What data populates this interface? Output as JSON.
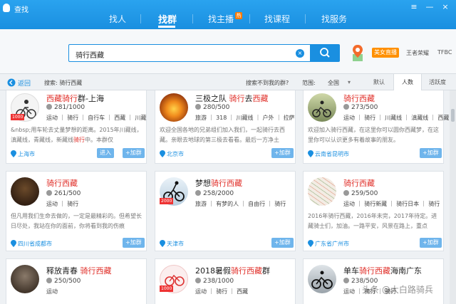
{
  "window": {
    "title": "查找",
    "controls": [
      "≡",
      "—",
      "×"
    ]
  },
  "nav": {
    "items": [
      "找人",
      "找群",
      "找主播",
      "找课程",
      "找服务"
    ],
    "active": "找群",
    "hot_badge": "热"
  },
  "search": {
    "value": "骑行西藏",
    "clear_label": "×",
    "tags": [
      "美女直播",
      "王者荣耀",
      "TFBC"
    ]
  },
  "filter": {
    "back": "返回",
    "search_label": "搜索: 骑行西藏",
    "not_found": "搜索不到我的群?",
    "range_label": "范围:",
    "range_value": "全国",
    "sort_tabs": [
      "默认",
      "人数",
      "活跃度"
    ],
    "sort_active": "人数"
  },
  "cards": [
    {
      "name_hl1": "西藏骑行",
      "name_rest": "群-上海",
      "count": "281/1000",
      "tags": "运动 ｜ 骑行 ｜ 自行车 ｜ 西藏 ｜ 川藏",
      "desc": "&nbsp;用车轮去丈量梦想的距离。2015年川藏线，滇藏线，青藏线，新藏线骑行中。本群仅",
      "desc_hl": "骑行",
      "loc": "上海市",
      "btn1": "进入",
      "btn2": "+加群",
      "badge": "1000"
    },
    {
      "name_pre": "三极之队 ",
      "name_hl1": "骑行",
      "name_mid": "去",
      "name_hl2": "西藏",
      "count": "280/500",
      "tags": "旅游 ｜ 318 ｜ 川藏线 ｜ 户外 ｜ 拉萨",
      "desc": "欢迎全国各地的兄弟组们加入我们，一起骑行去西藏。亲眼去地球的第三极去看看。最后一方净土",
      "loc": "北京市",
      "btn2": "+加群"
    },
    {
      "name_hl1": "骑行西藏",
      "count": "273/500",
      "tags": "运动 ｜ 骑行 ｜ 川藏线 ｜ 滇藏线 ｜ 西藏",
      "desc": "欢迎加入骑行西藏，在这里你可以圆你西藏梦，在这里你可以认识更多有着故事的朋友。",
      "loc": "云南省昆明市",
      "btn2": "+加群"
    },
    {
      "name_hl1": "骑行西藏",
      "count": "261/500",
      "tags": "运动 ｜ 骑行",
      "desc": "但凡用我们生命去做的，一定是最精彩的。但希望长日尽处，我站在你的面前，你将看到我的伤痕",
      "loc": "四川省成都市",
      "btn2": "+加群"
    },
    {
      "name_pre": "梦想",
      "name_hl1": "骑行西藏",
      "count": "258/2000",
      "tags": "旅游 ｜ 有梦的人 ｜ 自由行 ｜ 骑行",
      "desc": "",
      "loc": "天津市",
      "btn2": "+加群",
      "badge": "2000"
    },
    {
      "name_hl1": "骑行西藏",
      "count": "259/500",
      "tags": "运动 ｜ 骑行新藏 ｜ 骑行日本 ｜ 骑行",
      "desc": "2016年骑行西藏，2016年未完，2017年待定。进藏骑士们，加油。一路平安，风景在路上，重点",
      "loc": "广东省广州市",
      "btn2": "+加群"
    },
    {
      "name_pre": "释放青春 ",
      "name_hl1": "骑行西藏",
      "count": "250/500",
      "tags": "运动"
    },
    {
      "name_pre": "2018暑假",
      "name_hl1": "骑行西藏",
      "name_rest": "群",
      "count": "238/1000",
      "tags": "运动 ｜ 骑行 ｜ 西藏",
      "badge": "1000"
    },
    {
      "name_pre": "单车",
      "name_hl1": "骑行西藏",
      "name_rest": "海南广东",
      "count": "238/500",
      "tags": "运动 ｜ 骑行 ｜ 骑行"
    }
  ],
  "watermark": "头条 @大白路骑兵",
  "colors": {
    "primary": "#1a8fe0",
    "highlight": "#e0302a",
    "button": "#6fb5ec",
    "hot": "#ff9000"
  }
}
